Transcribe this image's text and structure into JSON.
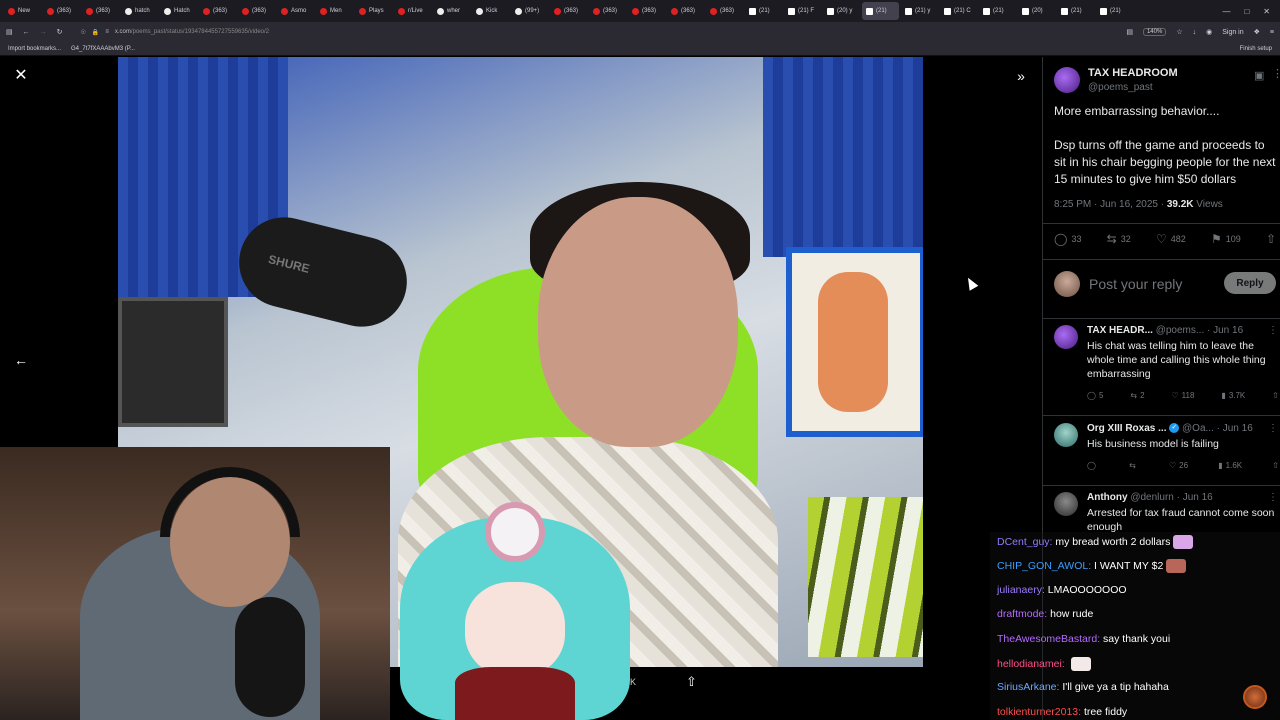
{
  "browser": {
    "tabs": [
      {
        "label": "New",
        "fav": "red"
      },
      {
        "label": "(363)",
        "fav": "red"
      },
      {
        "label": "(363)",
        "fav": "red"
      },
      {
        "label": "hatch",
        "fav": "white"
      },
      {
        "label": "Hatch",
        "fav": "white"
      },
      {
        "label": "(363)",
        "fav": "red"
      },
      {
        "label": "(363)",
        "fav": "red"
      },
      {
        "label": "Asmo",
        "fav": "red"
      },
      {
        "label": "Men",
        "fav": "red"
      },
      {
        "label": "Plays",
        "fav": "red"
      },
      {
        "label": "r/Live",
        "fav": "red"
      },
      {
        "label": "wher",
        "fav": "white"
      },
      {
        "label": "Kick",
        "fav": "white"
      },
      {
        "label": "(99+)",
        "fav": "white"
      },
      {
        "label": "(363)",
        "fav": "red"
      },
      {
        "label": "(363)",
        "fav": "red"
      },
      {
        "label": "(363)",
        "fav": "red"
      },
      {
        "label": "(363)",
        "fav": "red"
      },
      {
        "label": "(363)",
        "fav": "red"
      },
      {
        "label": "(21)",
        "fav": "x"
      },
      {
        "label": "(21) F",
        "fav": "x"
      },
      {
        "label": "(20) y",
        "fav": "x"
      },
      {
        "label": "(21)",
        "fav": "x",
        "active": true
      },
      {
        "label": "(21) y",
        "fav": "x"
      },
      {
        "label": "(21) C",
        "fav": "x"
      },
      {
        "label": "(21)",
        "fav": "x"
      },
      {
        "label": "(20)",
        "fav": "x"
      },
      {
        "label": "(21)",
        "fav": "x"
      },
      {
        "label": "(21)",
        "fav": "x"
      }
    ],
    "url_host": "x.com",
    "url_path": "/poems_past/status/1934784455727559635/video/2",
    "zoom": "140%",
    "sign_in": "Sign in",
    "bookmarks": [
      "Import bookmarks...",
      "G4_7t7fXAAAbvM3 (P..."
    ],
    "bookmark_right": "Finish setup"
  },
  "viewer": {
    "mic_brand": "SHURE",
    "video_views": "39K"
  },
  "post": {
    "author": "TAX HEADROOM",
    "handle": "@poems_past",
    "text1": "More embarrassing behavior....",
    "text2": "Dsp turns off the game and proceeds to sit in his chair begging people for the next 15 minutes to give him $50 dollars",
    "time": "8:25 PM · Jun 16, 2025 · ",
    "views_count": "39.2K",
    "views_label": " Views",
    "stats": {
      "replies": "33",
      "reposts": "32",
      "likes": "482",
      "bookmarks": "109"
    },
    "reply_placeholder": "Post your reply",
    "reply_button": "Reply"
  },
  "comments": [
    {
      "name": "TAX HEADR...",
      "sub": " @poems... · Jun 16",
      "text": "His chat was telling him to leave the whole time and calling this whole thing embarrassing",
      "replies": "5",
      "reposts": "2",
      "likes": "118",
      "views": "3.7K",
      "verified": false
    },
    {
      "name": "Org XIII Roxas ...",
      "sub": " @Oa... · Jun 16",
      "text": "His business model is failing",
      "replies": "",
      "reposts": "",
      "likes": "26",
      "views": "1.6K",
      "verified": true
    },
    {
      "name": "Anthony",
      "sub": " @denlurn · Jun 16",
      "text": "Arrested for tax fraud cannot come soon enough",
      "verified": false
    }
  ],
  "chat": [
    {
      "user": "DCent_guy:",
      "msg": " my bread worth 2 dollars",
      "color": "#8f7bff",
      "emote": "#d9a6e8"
    },
    {
      "user": "CHIP_GON_AWOL:",
      "msg": " I WANT MY $2",
      "color": "#3b9dff",
      "emote": "#b8655a"
    },
    {
      "user": "julianaery:",
      "msg": " LMAOOOOOOO",
      "color": "#9b7bff"
    },
    {
      "user": "draftmode:",
      "msg": " how rude",
      "color": "#b46bff"
    },
    {
      "user": "TheAwesomeBastard:",
      "msg": " say thank youi",
      "color": "#b46bff"
    },
    {
      "user": "hellodianamei:",
      "msg": " ",
      "color": "#ff4d8b",
      "emote": "#f3e9e9"
    },
    {
      "user": "SiriusArkane:",
      "msg": " I'll give ya a tip hahaha",
      "color": "#6fa8ff"
    },
    {
      "user": "tolkienturner2013:",
      "msg": " tree fiddy",
      "color": "#ff4d4d"
    }
  ]
}
